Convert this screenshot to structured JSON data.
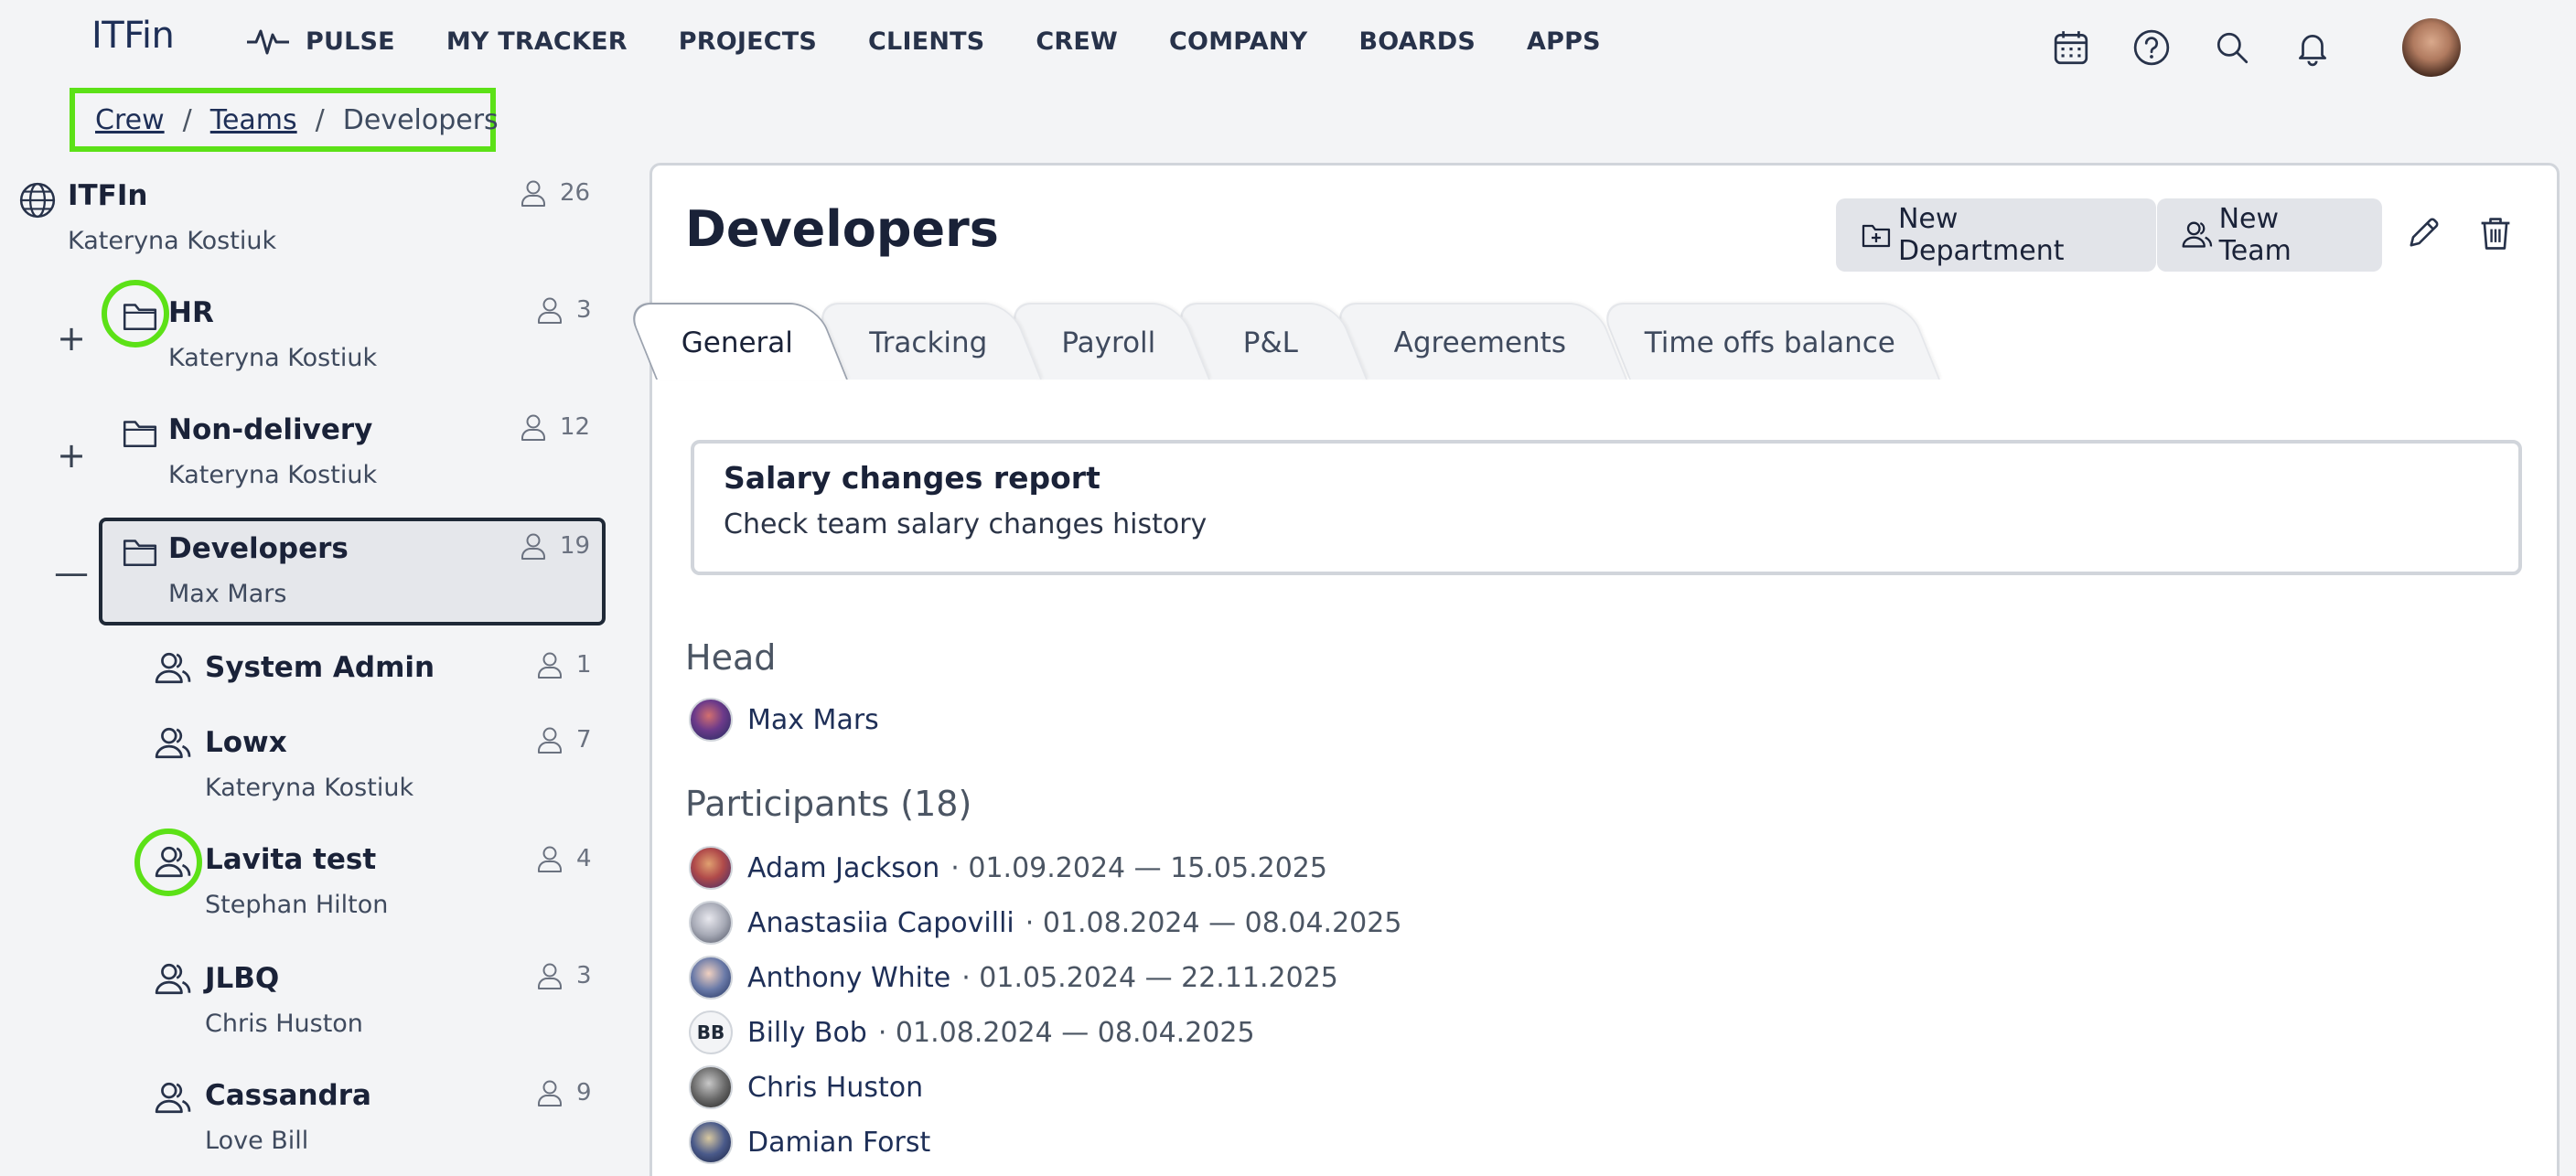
{
  "app": {
    "logo": "ITFin"
  },
  "nav": {
    "items": [
      "PULSE",
      "MY TRACKER",
      "PROJECTS",
      "CLIENTS",
      "CREW",
      "COMPANY",
      "BOARDS",
      "APPS"
    ],
    "icons": [
      "calendar-icon",
      "help-icon",
      "search-icon",
      "bell-icon"
    ]
  },
  "breadcrumb": {
    "crew": "Crew",
    "teams": "Teams",
    "current": "Developers",
    "sep": "/"
  },
  "tree": {
    "root": {
      "name": "ITFIn",
      "owner": "Kateryna Kostiuk",
      "count": "26"
    },
    "items": [
      {
        "name": "HR",
        "owner": "Kateryna Kostiuk",
        "count": "3",
        "expander": "+",
        "type": "folder"
      },
      {
        "name": "Non-delivery",
        "owner": "Kateryna Kostiuk",
        "count": "12",
        "expander": "+",
        "type": "folder"
      },
      {
        "name": "Developers",
        "owner": "Max Mars",
        "count": "19",
        "expander": "—",
        "type": "folder",
        "selected": true
      },
      {
        "name": "System Admin",
        "owner": "",
        "count": "1",
        "type": "team"
      },
      {
        "name": "Lowx",
        "owner": "Kateryna Kostiuk",
        "count": "7",
        "type": "team"
      },
      {
        "name": "Lavita test",
        "owner": "Stephan Hilton",
        "count": "4",
        "type": "team"
      },
      {
        "name": "JLBQ",
        "owner": "Chris Huston",
        "count": "3",
        "type": "team"
      },
      {
        "name": "Cassandra",
        "owner": "Love Bill",
        "count": "9",
        "type": "team"
      }
    ]
  },
  "panel": {
    "title": "Developers",
    "buttons": {
      "new_department": "New Department",
      "new_team": "New Team"
    },
    "tabs": [
      "General",
      "Tracking",
      "Payroll",
      "P&L",
      "Agreements",
      "Time offs balance"
    ],
    "active_tab": "General",
    "report": {
      "title": "Salary changes report",
      "description": "Check team salary changes history"
    },
    "head_label": "Head",
    "head": {
      "name": "Max Mars"
    },
    "participants_label": "Participants (18)",
    "participants": [
      {
        "name": "Adam Jackson",
        "dates": "· 01.09.2024 — 15.05.2025"
      },
      {
        "name": "Anastasiia Capovilli",
        "dates": "· 01.08.2024 — 08.04.2025"
      },
      {
        "name": "Anthony White",
        "dates": "· 01.05.2024 — 22.11.2025"
      },
      {
        "name": "Billy Bob",
        "dates": "· 01.08.2024 — 08.04.2025",
        "initials": "BB"
      },
      {
        "name": "Chris Huston",
        "dates": ""
      },
      {
        "name": "Damian Forst",
        "dates": ""
      }
    ]
  },
  "colors": {
    "highlight": "#5ce117",
    "brand": "#1e2f57"
  }
}
